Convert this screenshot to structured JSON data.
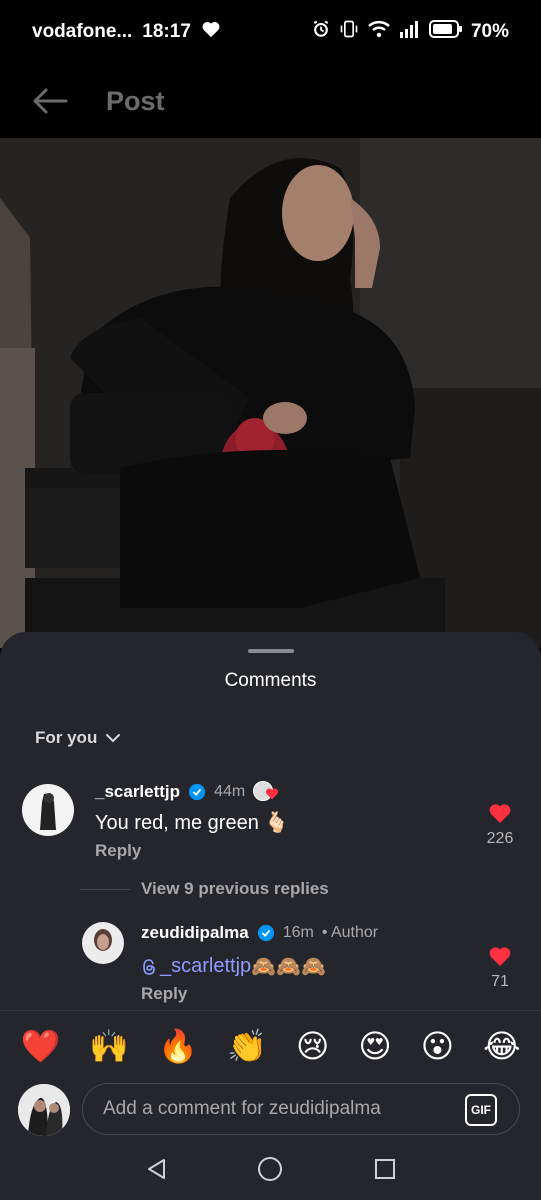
{
  "status": {
    "carrier": "vodafone...",
    "time": "18:17",
    "battery": "70%"
  },
  "header": {
    "title": "Post"
  },
  "sheet": {
    "title": "Comments",
    "sort_label": "For you"
  },
  "comments": [
    {
      "username": "_scarlettjp",
      "time": "44m",
      "text": "You red, me green 🫰🏻",
      "reply_label": "Reply",
      "likes": "226"
    }
  ],
  "view_replies": "View 9 previous replies",
  "reply": {
    "username": "zeudidipalma",
    "time": "16m",
    "author_label": "• Author",
    "mention": "_scarlettjp",
    "text": " 🙈🙈🙈",
    "reply_label": "Reply",
    "likes": "71"
  },
  "emojis": [
    "❤️",
    "🙌",
    "🔥",
    "👏",
    "😢",
    "😍",
    "😮",
    "😂"
  ],
  "input": {
    "placeholder": "Add a comment for zeudidipalma",
    "gif_label": "GIF"
  },
  "colors": {
    "like_red": "#ff3040",
    "verified_blue": "#0095f6",
    "mention": "#8d9bff",
    "sheet_bg": "#25262b"
  }
}
